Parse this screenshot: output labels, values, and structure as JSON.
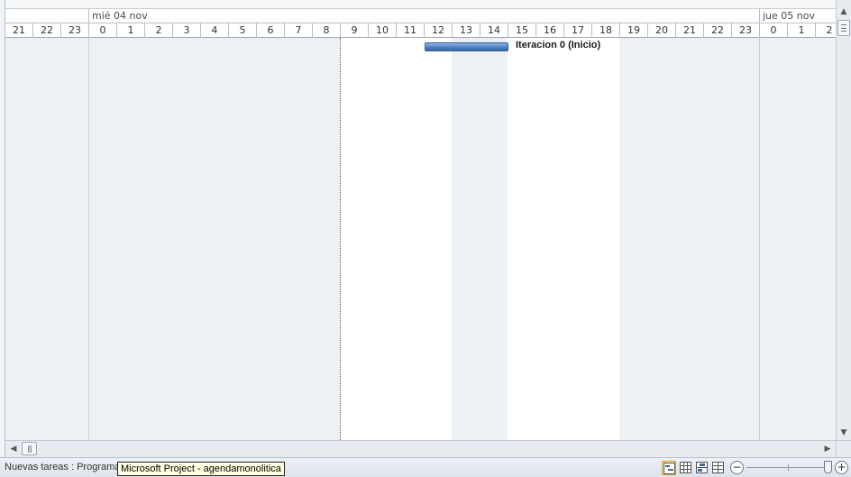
{
  "timescale": {
    "days": [
      "",
      "mié 04 nov",
      "jue 05 nov"
    ],
    "hours": [
      "21",
      "22",
      "23",
      "0",
      "1",
      "2",
      "3",
      "4",
      "5",
      "6",
      "7",
      "8",
      "9",
      "10",
      "11",
      "12",
      "13",
      "14",
      "15",
      "16",
      "17",
      "18",
      "19",
      "20",
      "21",
      "22",
      "23",
      "0",
      "1",
      "2"
    ]
  },
  "gantt": {
    "task_label": "Iteracion 0 (Inicio)"
  },
  "statusbar": {
    "text": "Nuevas tareas : Programa",
    "tooltip": "Microsoft Project - agendamonolitica"
  },
  "icons": {
    "scroll_up": "scroll-up-arrow-icon",
    "scroll_down": "scroll-down-arrow-icon",
    "scroll_left": "scroll-left-arrow-icon",
    "scroll_right": "scroll-right-arrow-icon",
    "view_gantt": "gantt-chart-view-icon",
    "view_task_usage": "task-usage-view-icon",
    "view_team_planner": "team-planner-view-icon",
    "view_resource_sheet": "resource-sheet-view-icon",
    "zoom_out": "zoom-out-icon",
    "zoom_in": "zoom-in-icon"
  },
  "colors": {
    "task_bar": "#4a7cc0",
    "nonworking_band": "#edf1f6",
    "working_band": "#ffffff",
    "tooltip_bg": "#ffffe1"
  }
}
